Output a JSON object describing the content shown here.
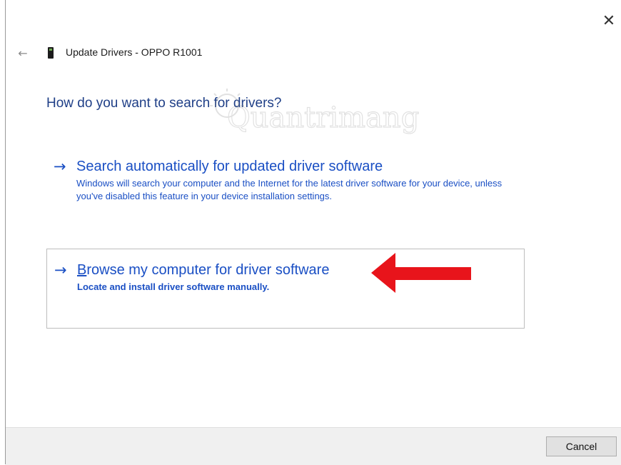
{
  "window": {
    "title": "Update Drivers - OPPO R1001",
    "close_glyph": "✕",
    "back_glyph": "←"
  },
  "main": {
    "question": "How do you want to search for drivers?",
    "watermark_text": "Quantrimang"
  },
  "options": {
    "auto": {
      "arrow": "→",
      "title": "Search automatically for updated driver software",
      "description": "Windows will search your computer and the Internet for the latest driver software for your device, unless you've disabled this feature in your device installation settings."
    },
    "browse": {
      "arrow": "→",
      "title_access_key": "B",
      "title_rest": "rowse my computer for driver software",
      "description": "Locate and install driver software manually."
    }
  },
  "footer": {
    "cancel_label": "Cancel"
  },
  "colors": {
    "link_blue": "#1a4fc4",
    "heading_blue": "#1f3f87",
    "annotation_red": "#e8141b"
  },
  "icons": {
    "back": "arrow-left-icon",
    "close": "close-icon",
    "device": "phone-device-icon",
    "option_arrow": "arrow-right-icon"
  }
}
